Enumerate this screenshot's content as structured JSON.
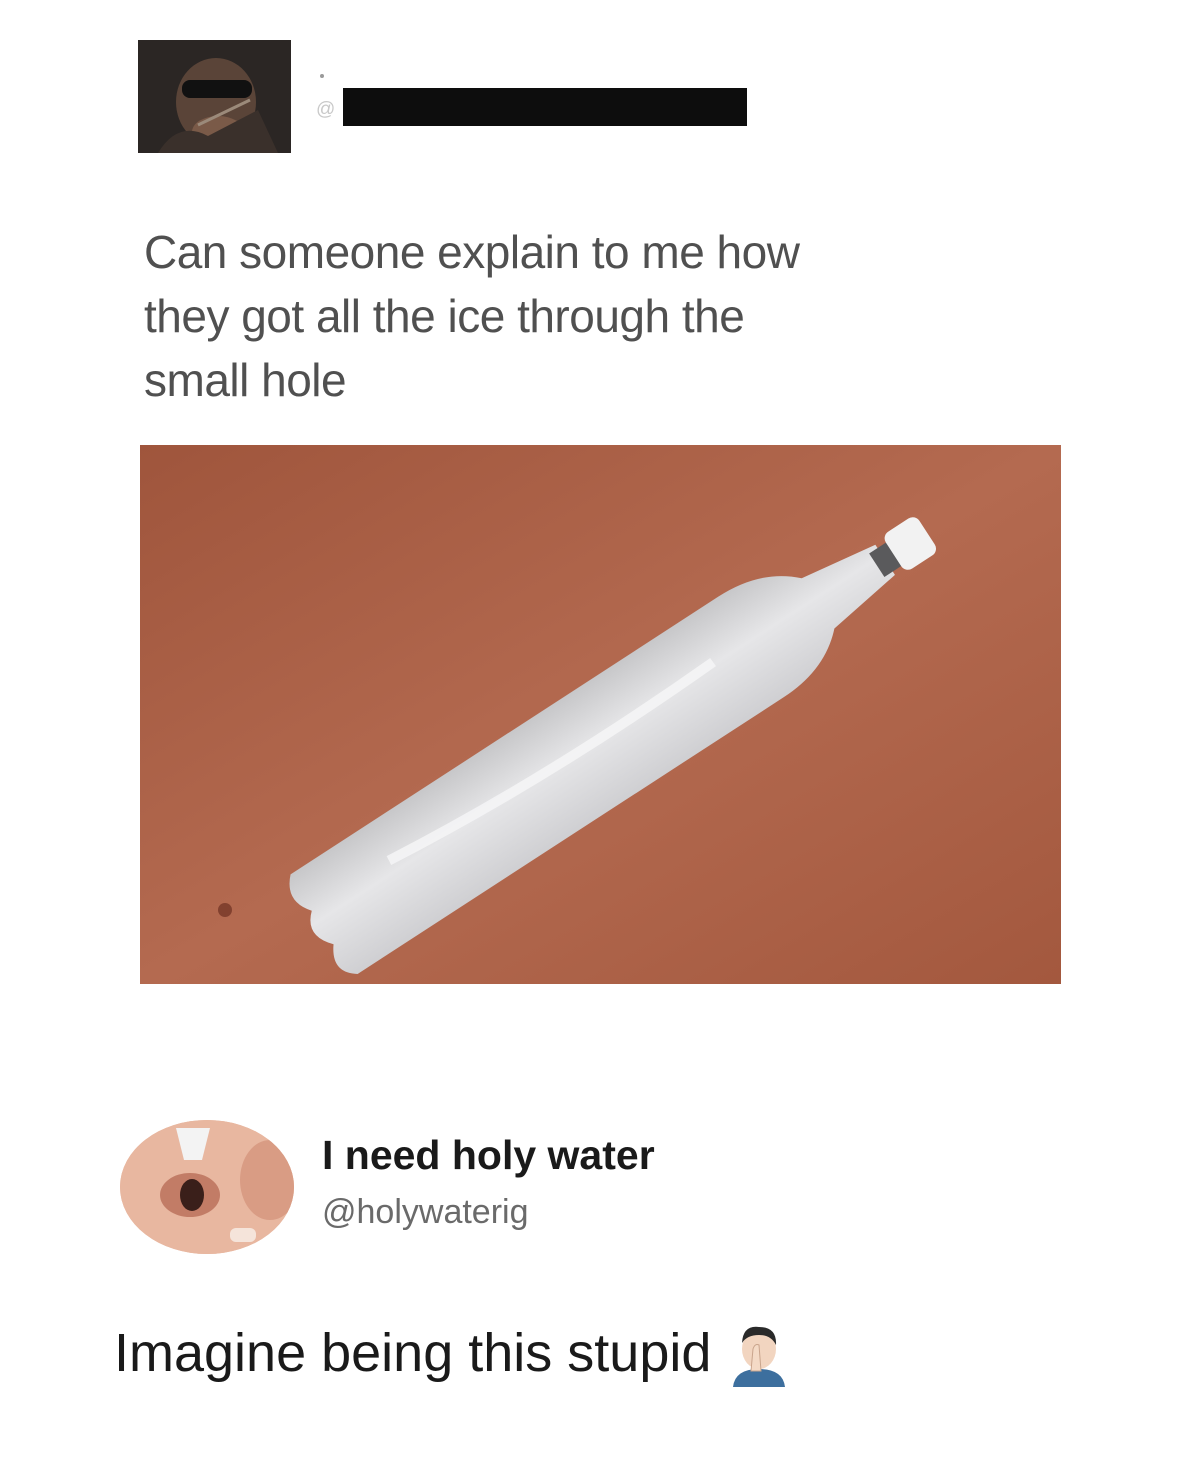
{
  "original_post": {
    "handle_prefix": "@",
    "text": "Can someone explain to me how\nthey got all the ice through the\nsmall hole"
  },
  "reply": {
    "display_name": "I need holy water",
    "handle": "@holywaterig",
    "text": "Imagine being this stupid",
    "emoji": "man-facepalming-icon"
  },
  "colors": {
    "background": "#ffffff",
    "post_text": "#505050",
    "reply_text": "#1a1a1a",
    "handle_text": "#6a6a6a",
    "redaction": "#0d0d0d",
    "photo_table": "#aa5e45"
  }
}
